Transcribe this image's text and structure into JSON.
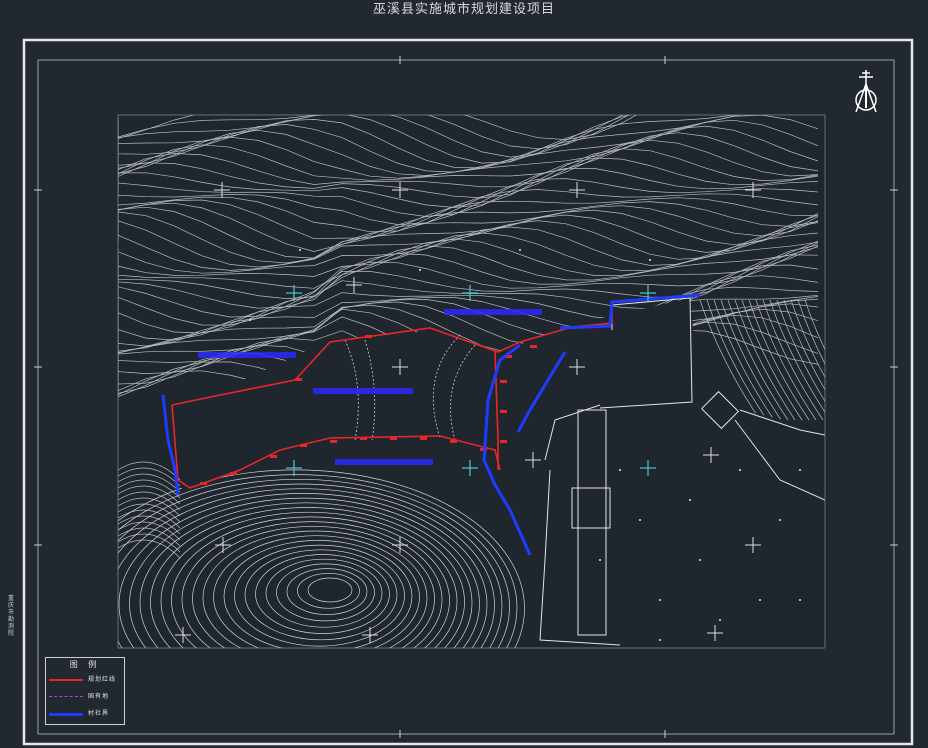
{
  "title": "巫溪县实施城市规划建设项目",
  "legend": {
    "heading": "图 例",
    "items": [
      {
        "label": "规划红线",
        "color": "#e8262a",
        "style": "solid"
      },
      {
        "label": "国有地",
        "color": "#c040d0",
        "style": "dashed"
      },
      {
        "label": "村社界",
        "color": "#1f3bff",
        "style": "solid"
      }
    ]
  },
  "side_text": "重庆市勘测院",
  "colors": {
    "background": "#212830",
    "contour": "#c9cdd2",
    "red_line": "#e8262a",
    "blue_line": "#1f3bff",
    "grid_white": "#e0e0e0",
    "grid_cyan": "#49c8d6"
  },
  "icons": {
    "north_arrow": "north-arrow-icon"
  }
}
